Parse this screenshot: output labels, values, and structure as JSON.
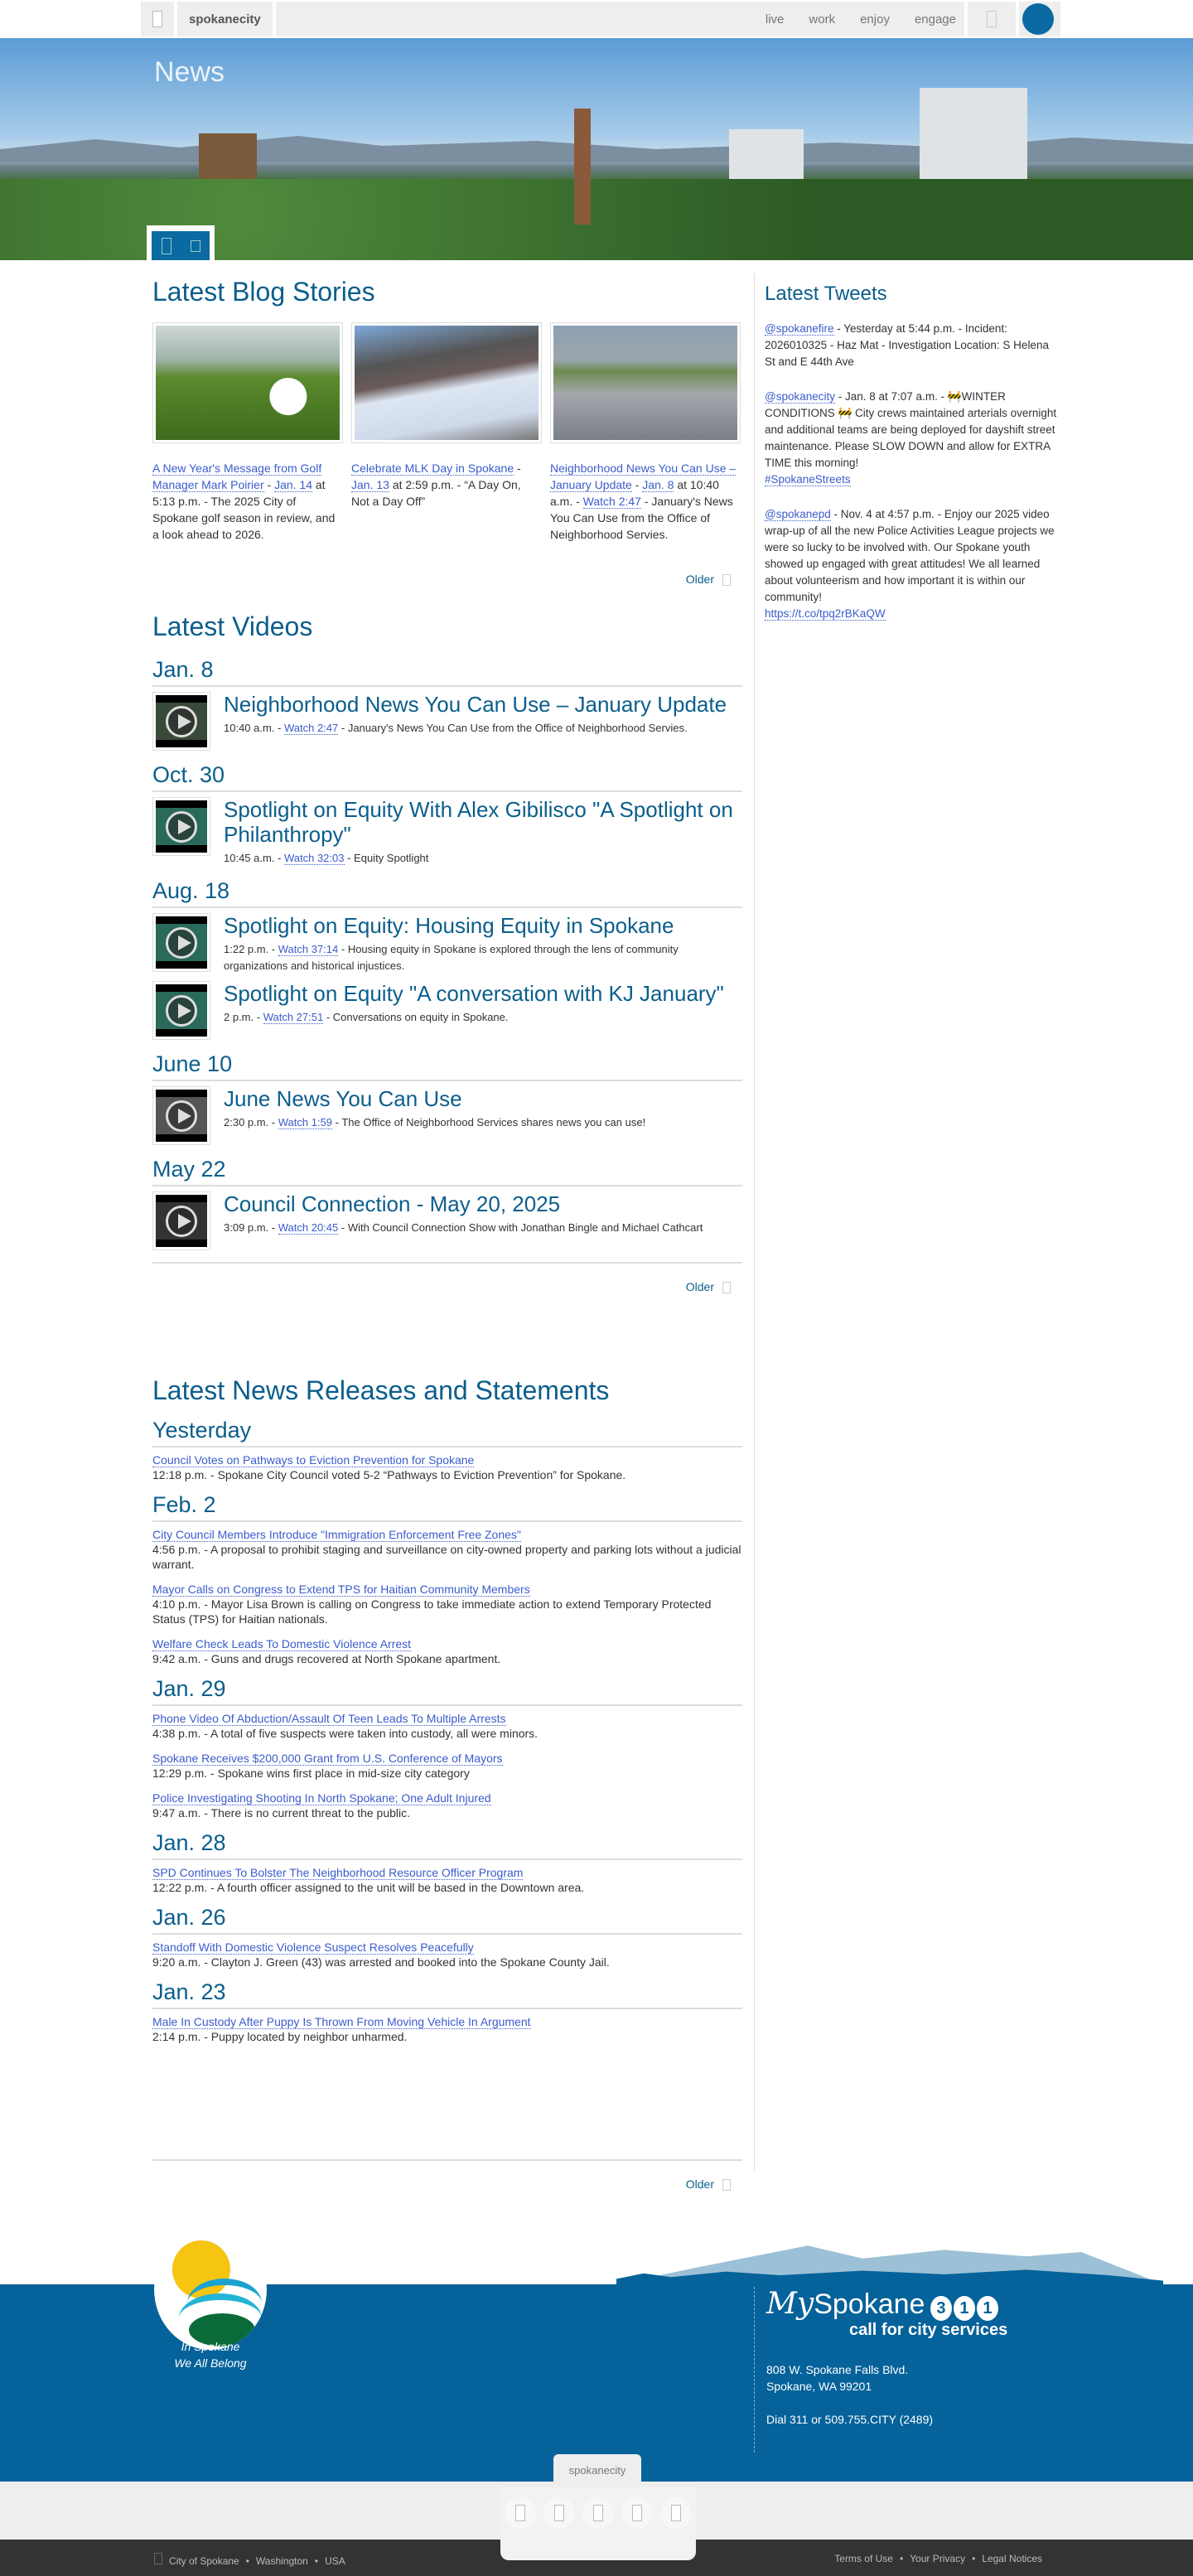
{
  "nav": {
    "brand": "spokanecity",
    "links": [
      "live",
      "work",
      "enjoy",
      "engage"
    ]
  },
  "hero": {
    "title": "News"
  },
  "blog": {
    "title": "Latest Blog Stories",
    "older": "Older",
    "items": [
      {
        "link": "A New Year's Message from Golf Manager Mark Poirier",
        "date": "Jan. 14",
        "rest": " at 5:13 p.m. - The 2025 City of Spokane golf season in review, and a look ahead to 2026."
      },
      {
        "link": "Celebrate MLK Day in Spokane",
        "date": "Jan. 13",
        "rest": " at 2:59 p.m. - “A Day On, Not a Day Off”"
      },
      {
        "link": "Neighborhood News You Can Use – January Update",
        "date": "Jan. 8",
        "rest": " at 10:40 a.m. - ",
        "watch": "Watch 2:47",
        "rest2": " - January's News You Can Use from the Office of Neighborhood Servies."
      }
    ]
  },
  "videos": {
    "title": "Latest Videos",
    "older": "Older",
    "groups": [
      {
        "date": "Jan. 8",
        "items": [
          {
            "title": "Neighborhood News You Can Use – January Update",
            "time": "10:40 a.m. - ",
            "watch": "Watch 2:47",
            "desc": " - January's News You Can Use from the Office of Neighborhood Servies."
          }
        ]
      },
      {
        "date": "Oct. 30",
        "items": [
          {
            "title": "Spotlight on Equity With Alex Gibilisco \"A Spotlight on Philanthropy\"",
            "time": "10:45 a.m. - ",
            "watch": "Watch 32:03",
            "desc": " - Equity Spotlight"
          }
        ]
      },
      {
        "date": "Aug. 18",
        "items": [
          {
            "title": "Spotlight on Equity: Housing Equity in Spokane",
            "time": "1:22 p.m. - ",
            "watch": "Watch 37:14",
            "desc": " - Housing equity in Spokane is explored through the lens of community organizations and historical injustices."
          },
          {
            "title": "Spotlight on Equity \"A conversation with KJ January\"",
            "time": "2 p.m. - ",
            "watch": "Watch 27:51",
            "desc": " - Conversations on equity in Spokane."
          }
        ]
      },
      {
        "date": "June 10",
        "items": [
          {
            "title": "June News You Can Use",
            "time": "2:30 p.m. - ",
            "watch": "Watch 1:59",
            "desc": " - The Office of Neighborhood Services shares news you can use!"
          }
        ]
      },
      {
        "date": "May 22",
        "items": [
          {
            "title": "Council Connection - May 20, 2025",
            "time": "3:09 p.m. - ",
            "watch": "Watch 20:45",
            "desc": " - With Council Connection Show with Jonathan Bingle and Michael Cathcart"
          }
        ]
      }
    ]
  },
  "news": {
    "title": "Latest News Releases and Statements",
    "older": "Older",
    "groups": [
      {
        "date": "Yesterday",
        "items": [
          {
            "link": "Council Votes on Pathways to Eviction Prevention for Spokane",
            "desc": "12:18 p.m. - Spokane City Council voted 5-2 “Pathways to Eviction Prevention” for Spokane."
          }
        ]
      },
      {
        "date": "Feb. 2",
        "items": [
          {
            "link": "City Council Members Introduce \"Immigration Enforcement Free Zones\"",
            "desc": "4:56 p.m. - A proposal to prohibit staging and surveillance on city-owned property and parking lots without a judicial warrant."
          },
          {
            "link": "Mayor Calls on Congress to Extend TPS for Haitian Community Members",
            "desc": "4:10 p.m. - Mayor Lisa Brown is calling on Congress to take immediate action to extend Temporary Protected Status (TPS) for Haitian nationals."
          },
          {
            "link": "Welfare Check Leads To Domestic Violence Arrest",
            "desc": "9:42 a.m. - Guns and drugs recovered at North Spokane apartment."
          }
        ]
      },
      {
        "date": "Jan. 29",
        "items": [
          {
            "link": "Phone Video Of Abduction/Assault Of Teen Leads To Multiple Arrests",
            "desc": "4:38 p.m. - A total of five suspects were taken into custody, all were minors."
          },
          {
            "link": "Spokane Receives $200,000 Grant from U.S. Conference of Mayors",
            "desc": "12:29 p.m. - Spokane wins first place in mid-size city category"
          },
          {
            "link": "Police Investigating Shooting In North Spokane; One Adult Injured",
            "desc": "9:47 a.m. - There is no current threat to the public."
          }
        ]
      },
      {
        "date": "Jan. 28",
        "items": [
          {
            "link": "SPD Continues To Bolster The Neighborhood Resource Officer Program",
            "desc": "12:22 p.m. - A fourth officer assigned to the unit will be based in the Downtown area."
          }
        ]
      },
      {
        "date": "Jan. 26",
        "items": [
          {
            "link": "Standoff With Domestic Violence Suspect Resolves Peacefully",
            "desc": "9:20 a.m. - Clayton J. Green (43) was arrested and booked into the Spokane County Jail."
          }
        ]
      },
      {
        "date": "Jan. 23",
        "items": [
          {
            "link": "Male In Custody After Puppy Is Thrown From Moving Vehicle In Argument",
            "desc": "2:14 p.m. - Puppy located by neighbor unharmed."
          }
        ]
      }
    ]
  },
  "tweets": {
    "title": "Latest Tweets",
    "items": [
      {
        "handle": "@spokanefire",
        "text": " - Yesterday at 5:44 p.m. - Incident: 2026010325 - Haz Mat - Investigation Location: S Helena St and E 44th Ave"
      },
      {
        "handle": "@spokanecity",
        "text": " - Jan. 8 at 7:07 a.m. - 🚧WINTER CONDITIONS 🚧 City crews maintained arterials overnight and additional teams are being deployed for dayshift street maintenance. Please SLOW DOWN and allow for EXTRA TIME this morning!",
        "tag": "#SpokaneStreets"
      },
      {
        "handle": "@spokanepd",
        "text": " - Nov. 4 at 4:57 p.m. - Enjoy our 2025 video wrap-up of all the new Police Activities League projects we were so lucky to be involved with. Our Spokane youth showed up engaged with great attitudes! We all learned about volunteerism and how important it is within our community!",
        "tag": "https://t.co/tpq2rBKaQW"
      }
    ]
  },
  "footer": {
    "tagline1": "In Spokane",
    "tagline2": "We All Belong",
    "my": "My",
    "spokane": "Spokane",
    "digits": [
      "3",
      "1",
      "1"
    ],
    "call": "call for city services",
    "address1": "808 W. Spokane Falls Blvd.",
    "address2": "Spokane, WA 99201",
    "phone": "Dial 311 or 509.755.CITY (2489)",
    "pill": "spokanecity",
    "left": [
      "City of Spokane",
      "Washington",
      "USA"
    ],
    "right": [
      "Terms of Use",
      "Your Privacy",
      "Legal Notices"
    ]
  },
  "colors": {
    "brand": "#05629a",
    "heading": "#0b5e8c",
    "link": "#3b5ccc"
  }
}
